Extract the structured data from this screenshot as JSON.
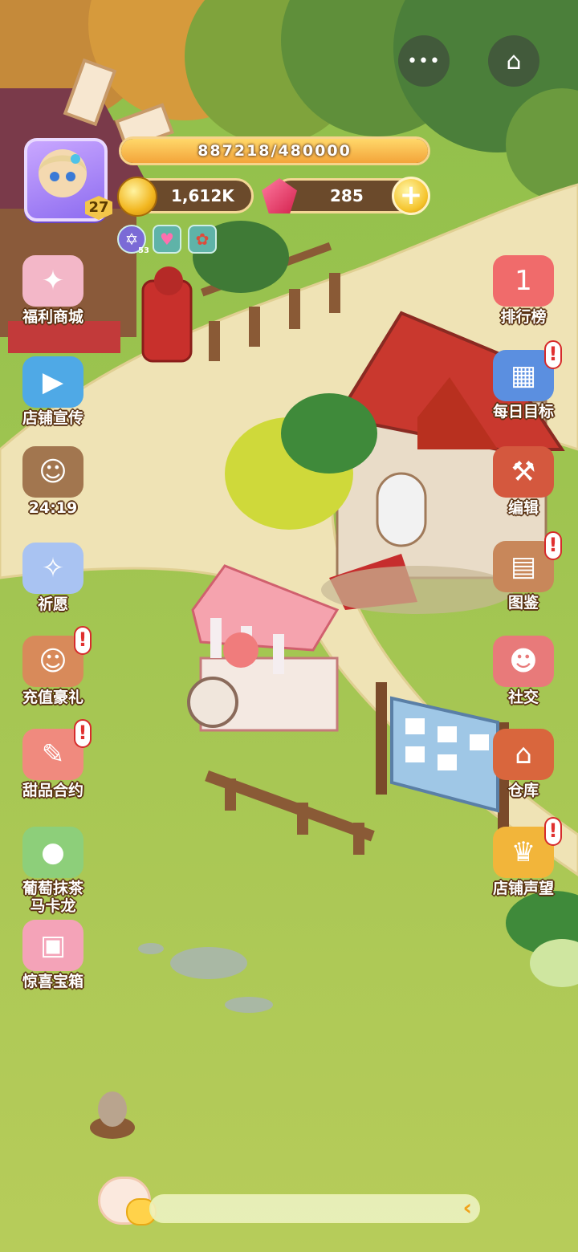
{
  "system": {
    "more_icon": "more-dots-icon",
    "home_icon": "home-icon",
    "more_glyph": "•••",
    "home_glyph": "⌂"
  },
  "hud": {
    "level": "27",
    "xp_text": "887218/480000",
    "xp_fill_fraction": 1.0,
    "coins": "1,612K",
    "gems": "285",
    "plus_glyph": "+",
    "buff_star_count": "53",
    "buff_star_glyph": "✡",
    "buff_heart_glyph": "♥",
    "buff_flower_glyph": "✿"
  },
  "left_menu": [
    {
      "id": "welfare-shop",
      "label": "福利商城",
      "glyph": "✦",
      "color": "#f3b7c8",
      "alert": false
    },
    {
      "id": "shop-promo",
      "label": "店铺宣传",
      "glyph": "▶",
      "color": "#4fa9e6",
      "alert": false
    },
    {
      "id": "npc-timer",
      "label": "24:19",
      "glyph": "☺",
      "color": "#a2764f",
      "alert": false
    },
    {
      "id": "wish",
      "label": "祈愿",
      "glyph": "✧",
      "color": "#a9c3f2",
      "alert": false
    },
    {
      "id": "recharge-gift",
      "label": "充值豪礼",
      "glyph": "☺",
      "color": "#d88a5a",
      "alert": true
    },
    {
      "id": "dessert-contract",
      "label": "甜品合约",
      "glyph": "✎",
      "color": "#f08a7e",
      "alert": true
    },
    {
      "id": "grape-matcha",
      "label": "葡萄抹茶\n马卡龙",
      "glyph": "●",
      "color": "#8dcf7a",
      "alert": false
    },
    {
      "id": "surprise-box",
      "label": "惊喜宝箱",
      "glyph": "▣",
      "color": "#f4a3b8",
      "alert": false
    }
  ],
  "right_menu": [
    {
      "id": "leaderboard",
      "label": "排行榜",
      "glyph": "1",
      "color": "#f06b6b",
      "alert": false
    },
    {
      "id": "daily-goals",
      "label": "每日目标",
      "glyph": "▦",
      "color": "#5b8fe0",
      "alert": true
    },
    {
      "id": "edit",
      "label": "编辑",
      "glyph": "⚒",
      "color": "#d4583e",
      "alert": false
    },
    {
      "id": "collection",
      "label": "图鉴",
      "glyph": "▤",
      "color": "#c8875a",
      "alert": true
    },
    {
      "id": "social",
      "label": "社交",
      "glyph": "☻",
      "color": "#e87a7a",
      "alert": false
    },
    {
      "id": "warehouse",
      "label": "仓库",
      "glyph": "⌂",
      "color": "#d9663d",
      "alert": false
    },
    {
      "id": "shop-reputation",
      "label": "店铺声望",
      "glyph": "♛",
      "color": "#f2b53a",
      "alert": true
    }
  ],
  "alert_glyph": "!",
  "chat": {
    "arrow_glyph": "‹"
  },
  "colors": {
    "grass": "#9cc24a",
    "path": "#efe3b5",
    "roof_red": "#c9382e",
    "label_outline": "#5a3212"
  }
}
